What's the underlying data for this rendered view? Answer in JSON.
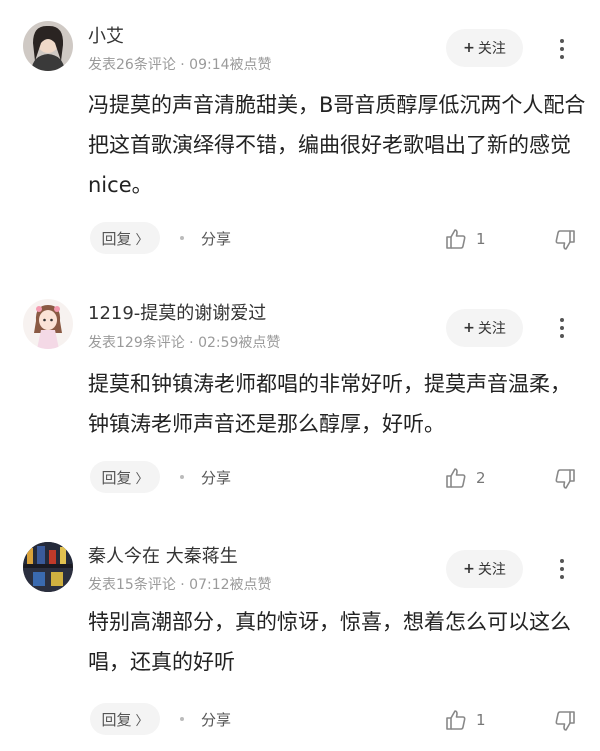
{
  "comments": [
    {
      "username": "小艾",
      "meta": "发表26条评论 · 09:14被点赞",
      "follow_label": "关注",
      "text": "冯提莫的声音清脆甜美，B哥音质醇厚低沉两个人配合把这首歌演绎得不错，编曲很好老歌唱出了新的感觉nice。",
      "reply_label": "回复",
      "share_label": "分享",
      "likes": "1"
    },
    {
      "username": "1219-提莫的谢谢爱过",
      "meta": "发表129条评论 · 02:59被点赞",
      "follow_label": "关注",
      "text": "提莫和钟镇涛老师都唱的非常好听，提莫声音温柔，钟镇涛老师声音还是那么醇厚，好听。",
      "reply_label": "回复",
      "share_label": "分享",
      "likes": "2"
    },
    {
      "username": "秦人今在 大秦蒋生",
      "meta": "发表15条评论 · 07:12被点赞",
      "follow_label": "关注",
      "text": "特别高潮部分，真的惊讶，惊喜，想着怎么可以这么唱，还真的好听",
      "reply_label": "回复",
      "share_label": "分享",
      "likes": "1"
    }
  ]
}
